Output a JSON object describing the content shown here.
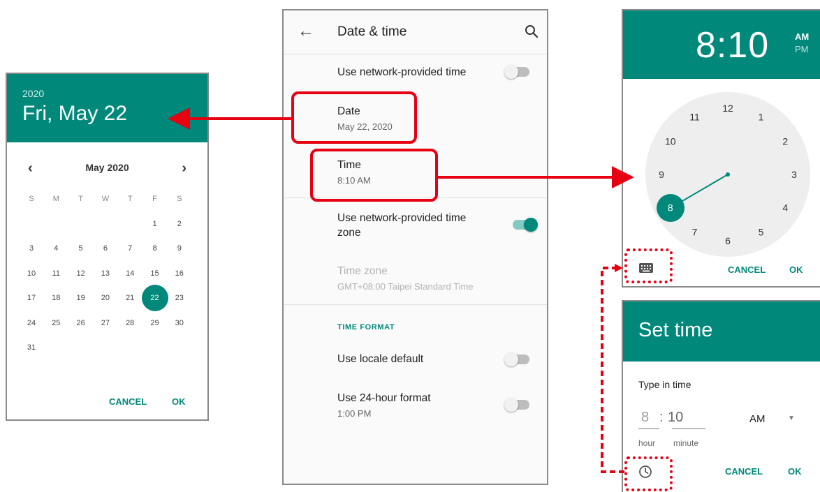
{
  "colors": {
    "accent": "#00897b",
    "annotation": "#e60012"
  },
  "date_picker": {
    "year": "2020",
    "date_label": "Fri, May 22",
    "month_label": "May 2020",
    "prev_icon": "chevron-left-icon",
    "next_icon": "chevron-right-icon",
    "weekday_headers": [
      "S",
      "M",
      "T",
      "W",
      "T",
      "F",
      "S"
    ],
    "weeks": [
      [
        "",
        "",
        "",
        "",
        "",
        "1",
        "2"
      ],
      [
        "3",
        "4",
        "5",
        "6",
        "7",
        "8",
        "9"
      ],
      [
        "10",
        "11",
        "12",
        "13",
        "14",
        "15",
        "16"
      ],
      [
        "17",
        "18",
        "19",
        "20",
        "21",
        "22",
        "23"
      ],
      [
        "24",
        "25",
        "26",
        "27",
        "28",
        "29",
        "30"
      ],
      [
        "31",
        "",
        "",
        "",
        "",
        "",
        ""
      ]
    ],
    "selected_day": "22",
    "cancel_label": "CANCEL",
    "ok_label": "OK"
  },
  "settings": {
    "title": "Date & time",
    "back_icon": "arrow-back-icon",
    "search_icon": "search-icon",
    "network_time": {
      "label": "Use network-provided time",
      "on": false
    },
    "date": {
      "title": "Date",
      "value": "May 22, 2020"
    },
    "time": {
      "title": "Time",
      "value": "8:10 AM"
    },
    "network_zone": {
      "label": "Use network-provided time zone",
      "line1": "Use network-provided time",
      "line2": "zone",
      "on": true
    },
    "time_zone": {
      "title": "Time zone",
      "value": "GMT+08:00 Taipei Standard Time",
      "enabled": false
    },
    "section_header": "TIME FORMAT",
    "locale_default": {
      "label": "Use locale default",
      "on": false
    },
    "hour24": {
      "label": "Use 24-hour format",
      "example": "1:00 PM",
      "on": false
    }
  },
  "clock_picker": {
    "time_display": "8:10",
    "am_label": "AM",
    "pm_label": "PM",
    "selected_period": "AM",
    "hour_numbers": [
      "12",
      "1",
      "2",
      "3",
      "4",
      "5",
      "6",
      "7",
      "8",
      "9",
      "10",
      "11"
    ],
    "selected_hour": "8",
    "keyboard_icon": "keyboard-icon",
    "cancel_label": "CANCEL",
    "ok_label": "OK"
  },
  "set_time": {
    "title": "Set time",
    "type_label": "Type in time",
    "hour_value": "8",
    "separator": ":",
    "minute_value": "10",
    "hour_label": "hour",
    "minute_label": "minute",
    "ampm_value": "AM",
    "dropdown_icon": "caret-down-icon",
    "clock_icon": "clock-icon",
    "cancel_label": "CANCEL",
    "ok_label": "OK"
  }
}
